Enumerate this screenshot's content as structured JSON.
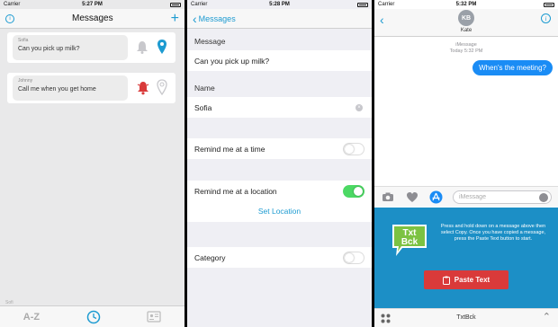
{
  "colors": {
    "accent": "#1d9bd1",
    "toggle_on": "#4cd964",
    "imessage_blue": "#1a8cf5",
    "extension_bg": "#1c8fc6",
    "paste_button": "#d93a3a",
    "bell_alert": "#d93a3a"
  },
  "screen1": {
    "status": {
      "carrier": "Carrier",
      "time": "5:27 PM"
    },
    "nav": {
      "title": "Messages",
      "info_icon": "info-icon",
      "add_icon": "plus-icon"
    },
    "messages": [
      {
        "from": "Sofia",
        "text": "Can you pick up milk?",
        "bell": "bell-icon",
        "pin": "location-pin-icon"
      },
      {
        "from": "Johnny",
        "text": "Call me when you get home",
        "bell": "bell-alert-icon",
        "pin": "location-pin-icon"
      }
    ],
    "section_label": "Sofi",
    "tabs": [
      {
        "label": "A-Z",
        "icon": "sort-az-icon"
      },
      {
        "icon": "clock-icon"
      },
      {
        "icon": "contacts-icon"
      }
    ]
  },
  "screen2": {
    "status": {
      "carrier": "Carrier",
      "time": "5:28 PM"
    },
    "nav": {
      "back_label": "Messages"
    },
    "message_label": "Message",
    "message_value": "Can you pick up milk?",
    "name_label": "Name",
    "name_value": "Sofia",
    "remind_time_label": "Remind me at a time",
    "remind_time_on": false,
    "remind_location_label": "Remind me at a location",
    "remind_location_on": true,
    "set_location_label": "Set Location",
    "category_label": "Category",
    "category_on": false
  },
  "screen3": {
    "status": {
      "carrier": "Carrier",
      "time": "5:32 PM"
    },
    "contact": {
      "initials": "KB",
      "name": "Kate"
    },
    "imessage_label": "iMessage",
    "imessage_time": "Today 5:32 PM",
    "sent_message": "When's the meeting?",
    "input_placeholder": "iMessage",
    "extension": {
      "logo_line1": "Txt",
      "logo_line2": "Bck",
      "instructions": "Press and hold down on a message above then select Copy. Once you have copied a message, press the Paste Text button to start.",
      "paste_button": "Paste Text"
    },
    "app_label": "TxtBck"
  }
}
